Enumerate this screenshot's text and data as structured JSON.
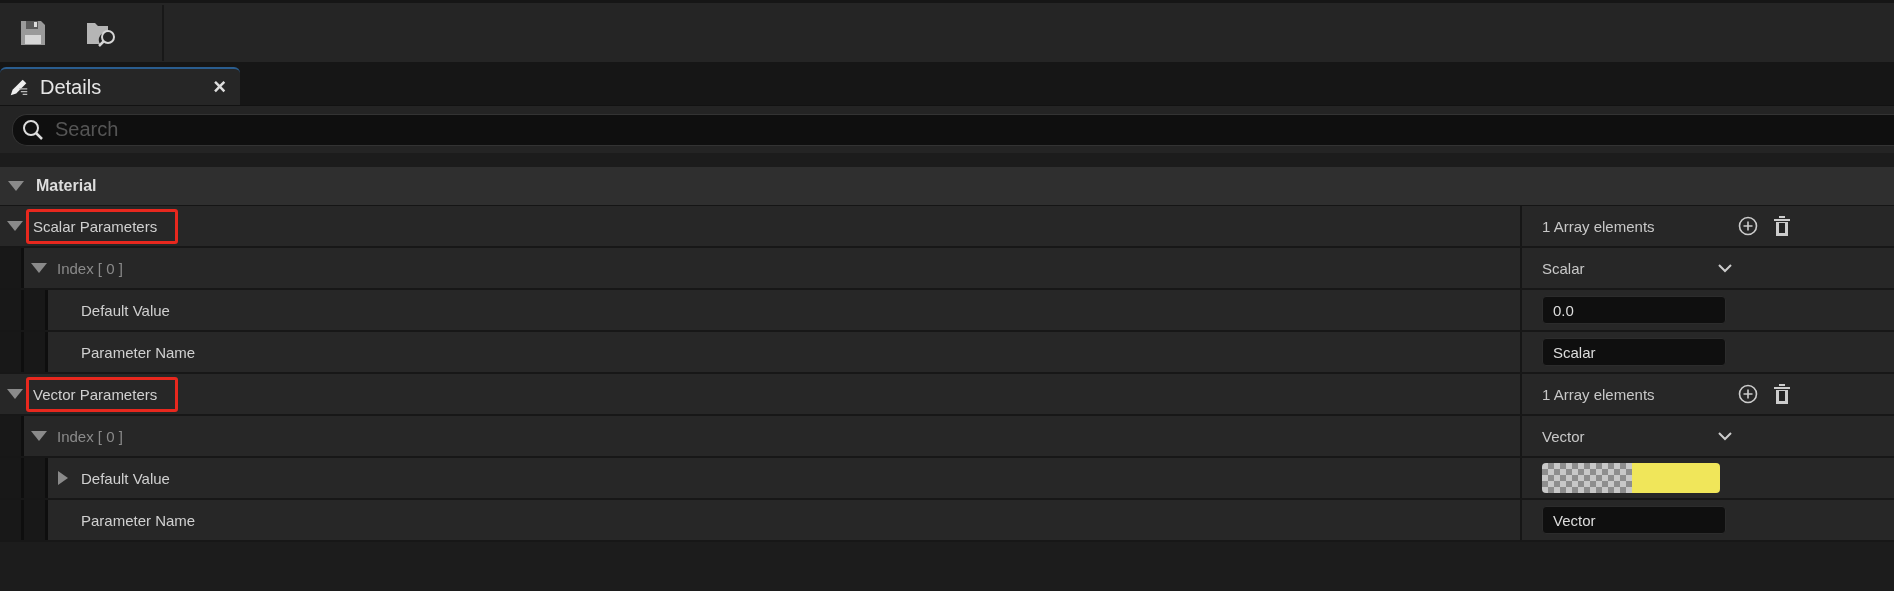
{
  "toolbar": {
    "buttons": [
      {
        "kind": "save"
      },
      {
        "kind": "browse"
      }
    ]
  },
  "tabs": [
    {
      "label": "Details",
      "selected": true,
      "close": "×"
    }
  ],
  "search": {
    "placeholder": "Search"
  },
  "category": {
    "label": "Material",
    "expanded": true,
    "children": [
      {
        "label": "Scalar Parameters",
        "highlighted": true,
        "expanded": true,
        "value": {
          "kind": "array",
          "text": "1 Array elements"
        },
        "children": [
          {
            "label": "Index [ 0 ]",
            "dim": true,
            "expanded": true,
            "value": {
              "kind": "dropdown",
              "text": "Scalar"
            },
            "children": [
              {
                "label": "Default Value",
                "value": {
                  "kind": "field",
                  "text": "0.0"
                }
              },
              {
                "label": "Parameter Name",
                "value": {
                  "kind": "field",
                  "text": "Scalar"
                }
              }
            ]
          }
        ]
      },
      {
        "label": "Vector Parameters",
        "highlighted": true,
        "expanded": true,
        "value": {
          "kind": "array",
          "text": "1 Array elements"
        },
        "children": [
          {
            "label": "Index [ 0 ]",
            "dim": true,
            "expanded": true,
            "value": {
              "kind": "dropdown",
              "text": "Vector"
            },
            "children": [
              {
                "label": "Default Value",
                "expanded": false,
                "value": {
                  "kind": "swatch",
                  "color": "#f0e65a"
                }
              },
              {
                "label": "Parameter Name",
                "value": {
                  "kind": "field",
                  "text": "Vector"
                }
              }
            ]
          }
        ]
      }
    ]
  }
}
